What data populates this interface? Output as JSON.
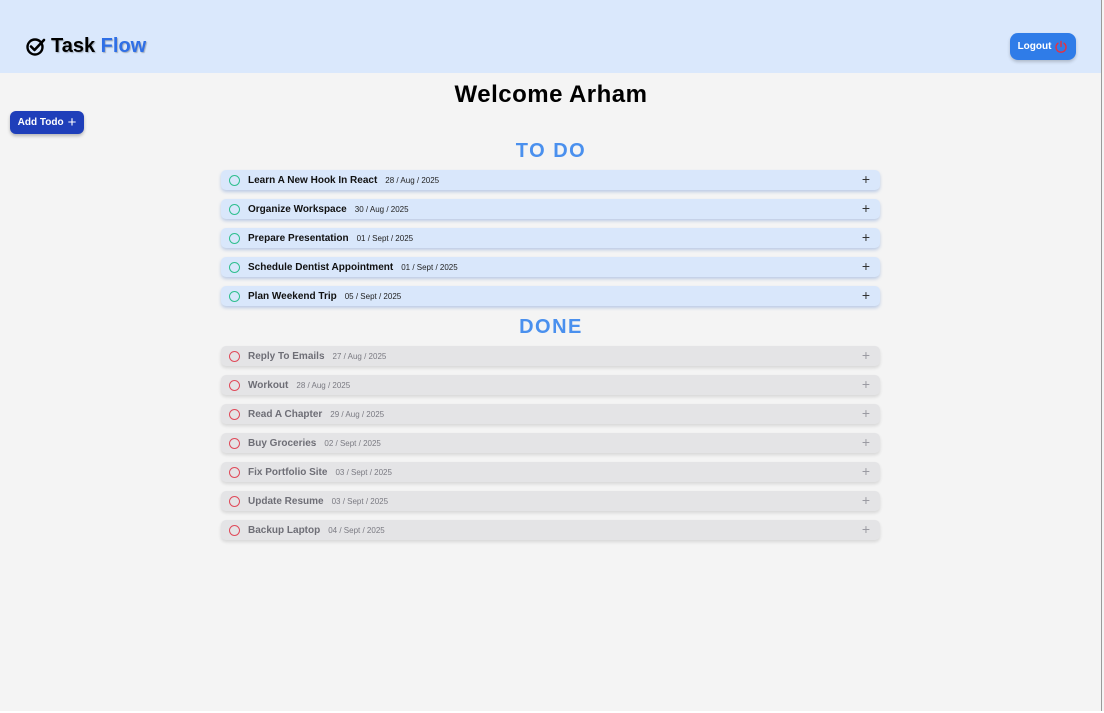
{
  "header": {
    "logo_icon": "check-circle-icon",
    "logo_text_main": "Task",
    "logo_text_accent": "Flow",
    "logout_label": "Logout",
    "logout_icon": "power-icon"
  },
  "welcome": {
    "prefix": "Welcome",
    "name": "Arham"
  },
  "add_todo": {
    "label": "Add Todo",
    "icon": "plus-icon"
  },
  "todo_section": {
    "title": "TO DO",
    "items": [
      {
        "title": "Learn A New Hook In React",
        "date": "28 / Aug / 2025"
      },
      {
        "title": "Organize Workspace",
        "date": "30 / Aug / 2025"
      },
      {
        "title": "Prepare Presentation",
        "date": "01 / Sept / 2025"
      },
      {
        "title": "Schedule Dentist Appointment",
        "date": "01 / Sept / 2025"
      },
      {
        "title": "Plan Weekend Trip",
        "date": "05 / Sept / 2025"
      }
    ]
  },
  "done_section": {
    "title": "DONE",
    "items": [
      {
        "title": "Reply To Emails",
        "date": "27 / Aug / 2025"
      },
      {
        "title": "Workout",
        "date": "28 / Aug / 2025"
      },
      {
        "title": "Read A Chapter",
        "date": "29 / Aug / 2025"
      },
      {
        "title": "Buy Groceries",
        "date": "02 / Sept / 2025"
      },
      {
        "title": "Fix Portfolio Site",
        "date": "03 / Sept / 2025"
      },
      {
        "title": "Update Resume",
        "date": "03 / Sept / 2025"
      },
      {
        "title": "Backup Laptop",
        "date": "04 / Sept / 2025"
      }
    ]
  },
  "colors": {
    "header_bg": "#dae8fc",
    "brand_accent": "#2f6fe6",
    "logout_bg": "#2f7ce8",
    "add_button_bg": "#1f3fba",
    "section_title": "#4a90ee",
    "todo_item_bg": "#d9e7fb",
    "done_item_bg": "#e4e4e6",
    "todo_check": "#2fbf8f",
    "done_check": "#e04a5a"
  }
}
